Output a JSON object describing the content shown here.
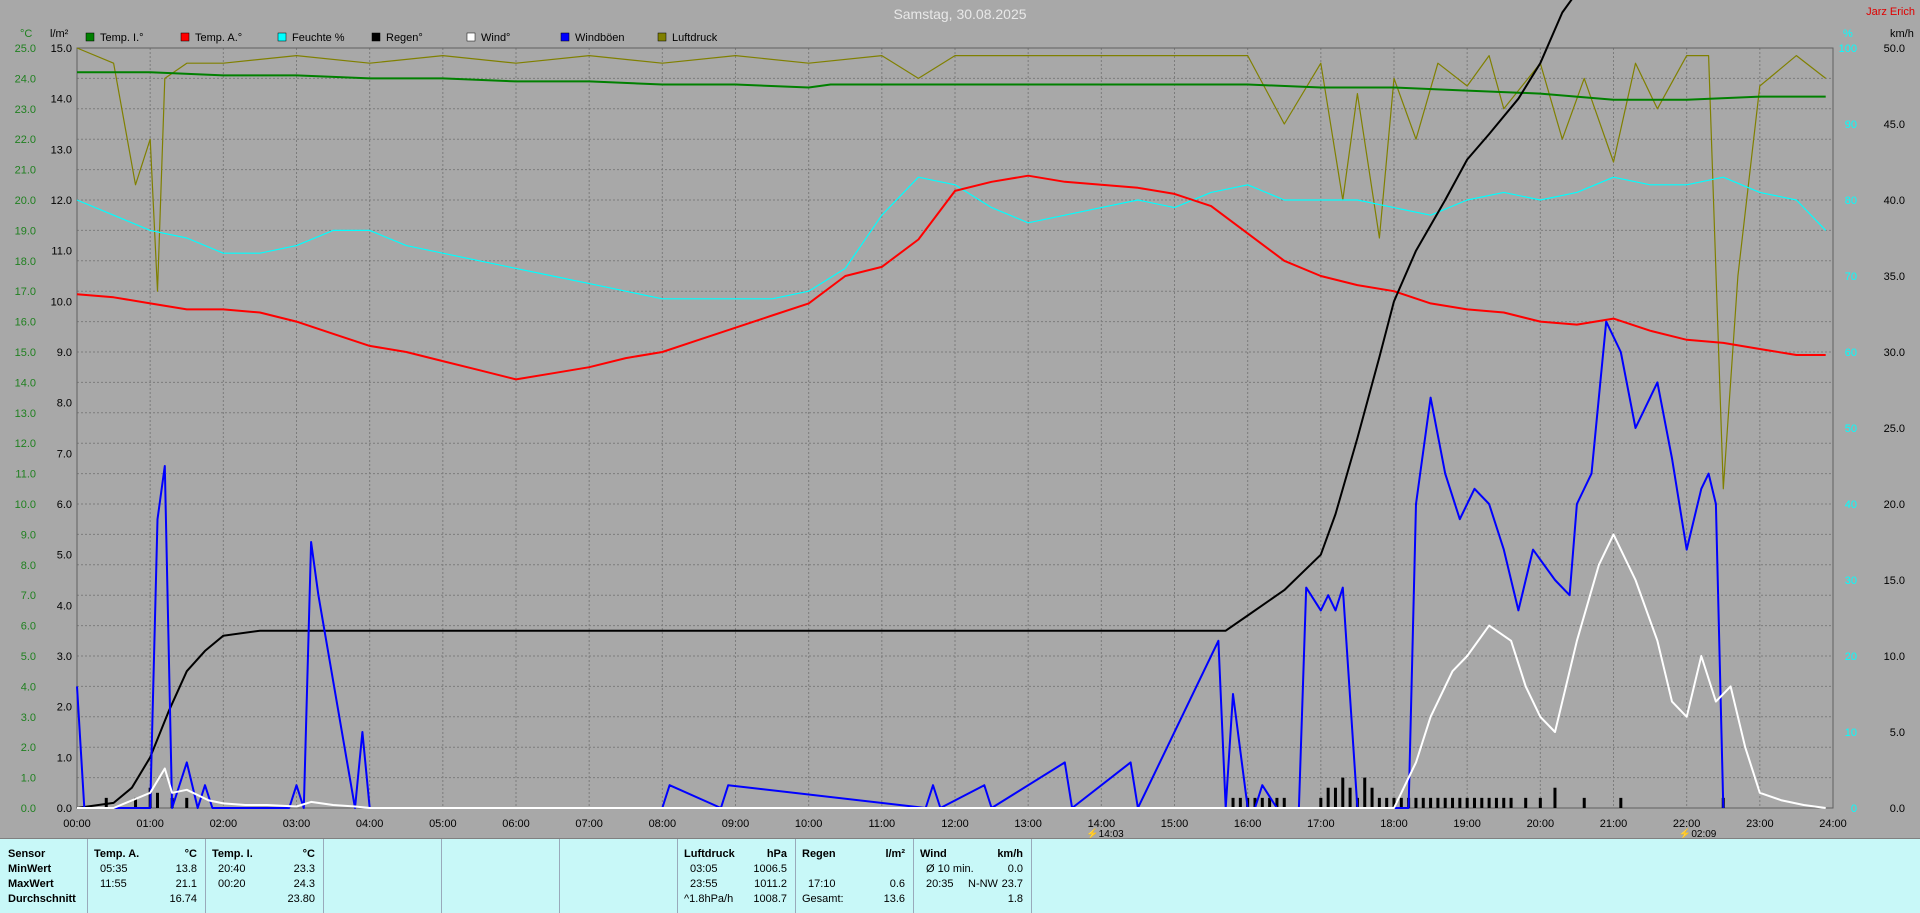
{
  "window": {
    "title": "Samstag, 30.08.2025",
    "credit": "Jarz Erich"
  },
  "axes": {
    "left_temp_unit": "°C",
    "left_rain_unit": "l/m²",
    "right_wind_unit": "km/h",
    "right_humidity_unit": "%",
    "temp_ticks": [
      "0.0",
      "1.0",
      "2.0",
      "3.0",
      "4.0",
      "5.0",
      "6.0",
      "7.0",
      "8.0",
      "9.0",
      "10.0",
      "11.0",
      "12.0",
      "13.0",
      "14.0",
      "15.0",
      "16.0",
      "17.0",
      "18.0",
      "19.0",
      "20.0",
      "21.0",
      "22.0",
      "23.0",
      "24.0",
      "25.0"
    ],
    "rain_ticks": [
      "0.0",
      "1.0",
      "2.0",
      "3.0",
      "4.0",
      "5.0",
      "6.0",
      "7.0",
      "8.0",
      "9.0",
      "10.0",
      "11.0",
      "12.0",
      "13.0",
      "14.0",
      "15.0"
    ],
    "wind_ticks": [
      "0.0",
      "5.0",
      "10.0",
      "15.0",
      "20.0",
      "25.0",
      "30.0",
      "35.0",
      "40.0",
      "45.0",
      "50.0"
    ],
    "humidity_ticks": [
      "0",
      "10",
      "20",
      "30",
      "40",
      "50",
      "60",
      "70",
      "80",
      "90",
      "100"
    ],
    "x_ticks": [
      "00:00",
      "01:00",
      "02:00",
      "03:00",
      "04:00",
      "05:00",
      "06:00",
      "07:00",
      "08:00",
      "09:00",
      "10:00",
      "11:00",
      "12:00",
      "13:00",
      "14:00",
      "15:00",
      "16:00",
      "17:00",
      "18:00",
      "19:00",
      "20:00",
      "21:00",
      "22:00",
      "23:00",
      "24:00"
    ],
    "sun_markers": [
      "14:03",
      "02:09"
    ]
  },
  "legend": [
    {
      "label": "Temp. I.°",
      "color": "#008000"
    },
    {
      "label": "Temp. A.°",
      "color": "#ff0000"
    },
    {
      "label": "Feuchte %",
      "color": "#00ffff"
    },
    {
      "label": "Regen°",
      "color": "#000000"
    },
    {
      "label": "Wind°",
      "color": "#ffffff"
    },
    {
      "label": "Windböen",
      "color": "#0000ff"
    },
    {
      "label": "Luftdruck",
      "color": "#808000"
    }
  ],
  "chart_data": {
    "type": "line",
    "title": "Samstag, 30.08.2025",
    "x_unit": "hour",
    "xlim": [
      0,
      24
    ],
    "temp_ylim": [
      0,
      25
    ],
    "rain_ylim": [
      0,
      15
    ],
    "wind_ylim": [
      0,
      50
    ],
    "humidity_ylim": [
      0,
      100
    ],
    "grid": true,
    "legend_position": "top",
    "series": [
      {
        "name": "Temp. I.°",
        "axis": "temp",
        "color": "#008000",
        "x": [
          0,
          1,
          2,
          3,
          4,
          5,
          6,
          7,
          8,
          9,
          10,
          10.3,
          11,
          12,
          13,
          14,
          15,
          16,
          17,
          18,
          19,
          20,
          21,
          22,
          23,
          23.9
        ],
        "y": [
          24.2,
          24.2,
          24.1,
          24.1,
          24.0,
          24.0,
          23.9,
          23.9,
          23.8,
          23.8,
          23.7,
          23.8,
          23.8,
          23.8,
          23.8,
          23.8,
          23.8,
          23.8,
          23.7,
          23.7,
          23.6,
          23.5,
          23.3,
          23.3,
          23.4,
          23.4
        ]
      },
      {
        "name": "Temp. A.°",
        "axis": "temp",
        "color": "#ff0000",
        "x": [
          0,
          0.5,
          1,
          1.5,
          2,
          2.5,
          3,
          3.5,
          4,
          4.5,
          5,
          5.5,
          6,
          6.5,
          7,
          7.5,
          8,
          8.5,
          9,
          9.5,
          10,
          10.5,
          11,
          11.5,
          12,
          12.5,
          13,
          13.5,
          14,
          14.5,
          15,
          15.5,
          16,
          16.5,
          17,
          17.5,
          18,
          18.5,
          19,
          19.5,
          20,
          20.5,
          21,
          21.5,
          22,
          22.5,
          23,
          23.5,
          23.9
        ],
        "y": [
          16.9,
          16.8,
          16.6,
          16.4,
          16.4,
          16.3,
          16.0,
          15.6,
          15.2,
          15.0,
          14.7,
          14.4,
          14.1,
          14.3,
          14.5,
          14.8,
          15.0,
          15.4,
          15.8,
          16.2,
          16.6,
          17.5,
          17.8,
          18.7,
          20.3,
          20.6,
          20.8,
          20.6,
          20.5,
          20.4,
          20.2,
          19.8,
          18.9,
          18.0,
          17.5,
          17.2,
          17.0,
          16.6,
          16.4,
          16.3,
          16.0,
          15.9,
          16.1,
          15.7,
          15.4,
          15.3,
          15.1,
          14.9,
          14.9
        ]
      },
      {
        "name": "Feuchte %",
        "axis": "humidity",
        "color": "#00ffff",
        "x": [
          0,
          0.5,
          1,
          1.5,
          2,
          2.5,
          3,
          3.5,
          4,
          4.5,
          5,
          5.5,
          6,
          6.5,
          7,
          7.5,
          8,
          8.5,
          9,
          9.5,
          10,
          10.5,
          11,
          11.5,
          12,
          12.5,
          13,
          13.5,
          14,
          14.5,
          15,
          15.5,
          16,
          16.5,
          17,
          17.5,
          18,
          18.5,
          19,
          19.5,
          20,
          20.5,
          21,
          21.5,
          22,
          22.5,
          23,
          23.5,
          23.9
        ],
        "y": [
          80,
          78,
          76,
          75,
          73,
          73,
          74,
          76,
          76,
          74,
          73,
          72,
          71,
          70,
          69,
          68,
          67,
          67,
          67,
          67,
          68,
          71,
          78,
          83,
          82,
          79,
          77,
          78,
          79,
          80,
          79,
          81,
          82,
          80,
          80,
          80,
          79,
          78,
          80,
          81,
          80,
          81,
          83,
          82,
          82,
          83,
          81,
          80,
          76
        ]
      },
      {
        "name": "Regen°",
        "axis": "rain",
        "color": "#000000",
        "x": [
          0,
          0.5,
          0.75,
          1,
          1.25,
          1.5,
          1.75,
          2,
          2.5,
          3,
          4,
          5,
          6,
          7,
          8,
          9,
          10,
          11,
          12,
          13,
          14,
          15,
          15.7,
          16,
          16.5,
          17,
          17.2,
          17.5,
          17.8,
          18,
          18.3,
          18.7,
          19,
          19.3,
          19.7,
          20,
          20.3,
          20.6,
          21,
          21.5,
          22,
          22.5,
          23,
          23.9
        ],
        "y": [
          0,
          0.1,
          0.4,
          1.0,
          1.9,
          2.7,
          3.1,
          3.4,
          3.5,
          3.5,
          3.5,
          3.5,
          3.5,
          3.5,
          3.5,
          3.5,
          3.5,
          3.5,
          3.5,
          3.5,
          3.5,
          3.5,
          3.5,
          3.8,
          4.3,
          5.0,
          5.8,
          7.3,
          8.9,
          10.0,
          11.0,
          12.0,
          12.8,
          13.3,
          14.0,
          14.7,
          15.7,
          16.3,
          16.8,
          16.9,
          16.9,
          17.1,
          17.2,
          17.2
        ]
      },
      {
        "name": "Wind°",
        "axis": "wind",
        "color": "#ffffff",
        "x": [
          0,
          0.5,
          1,
          1.2,
          1.3,
          1.5,
          1.8,
          2,
          2.3,
          2.6,
          3,
          3.2,
          3.5,
          3.8,
          4,
          5,
          6,
          7,
          8,
          9,
          10,
          11,
          12,
          13,
          14,
          15,
          16,
          17,
          18,
          18.3,
          18.5,
          18.8,
          19,
          19.3,
          19.6,
          19.8,
          20,
          20.2,
          20.5,
          20.8,
          21,
          21.3,
          21.6,
          21.8,
          22,
          22.2,
          22.4,
          22.6,
          22.8,
          23,
          23.3,
          23.6,
          23.9
        ],
        "y": [
          0,
          0,
          1,
          2.6,
          1,
          1.2,
          0.5,
          0.3,
          0.2,
          0.2,
          0.1,
          0.4,
          0.2,
          0.1,
          0,
          0,
          0,
          0,
          0,
          0,
          0,
          0,
          0,
          0,
          0,
          0,
          0,
          0,
          0,
          3,
          6,
          9,
          10,
          12,
          11,
          8,
          6,
          5,
          11,
          16,
          18,
          15,
          11,
          7,
          6,
          10,
          7,
          8,
          4,
          1,
          0.5,
          0.2,
          0
        ]
      },
      {
        "name": "Windböen",
        "axis": "wind",
        "color": "#0000ff",
        "x": [
          0,
          0.1,
          0.2,
          1.0,
          1.1,
          1.2,
          1.3,
          1.5,
          1.65,
          1.75,
          1.85,
          2.9,
          3.0,
          3.1,
          3.2,
          3.3,
          3.8,
          3.9,
          4.0,
          8.0,
          8.1,
          8.8,
          8.9,
          11.6,
          11.7,
          11.8,
          12.4,
          12.5,
          13.5,
          13.6,
          14.4,
          14.5,
          15.6,
          15.7,
          15.8,
          16.0,
          16.1,
          16.2,
          16.4,
          16.7,
          16.8,
          17.0,
          17.1,
          17.2,
          17.3,
          17.5,
          18.2,
          18.3,
          18.5,
          18.7,
          18.9,
          19.1,
          19.3,
          19.5,
          19.7,
          19.9,
          20.2,
          20.4,
          20.5,
          20.7,
          20.9,
          21.1,
          21.3,
          21.6,
          21.8,
          22.0,
          22.2,
          22.3,
          22.4,
          22.5
        ],
        "y": [
          8,
          0,
          0,
          0,
          19,
          22.5,
          0,
          3,
          0,
          1.5,
          0,
          0,
          1.5,
          0,
          17.5,
          14,
          0,
          5,
          0,
          0,
          1.5,
          0,
          1.5,
          0,
          1.5,
          0,
          1.5,
          0,
          3,
          0,
          3,
          0,
          11,
          0,
          7.5,
          0,
          0,
          1.5,
          0,
          0,
          14.5,
          13,
          14,
          13,
          14.5,
          0,
          0,
          20,
          27,
          22,
          19,
          21,
          20,
          17,
          13,
          17,
          15,
          14,
          20,
          22,
          32,
          30,
          25,
          28,
          23,
          17,
          21,
          22,
          20,
          0
        ]
      },
      {
        "name": "Luftdruck",
        "axis": "humidity",
        "color": "#808000",
        "x": [
          0,
          0.5,
          0.8,
          1.0,
          1.1,
          1.2,
          1.5,
          2,
          3,
          4,
          5,
          6,
          7,
          8,
          9,
          10,
          11,
          11.5,
          12,
          13,
          14,
          15,
          16,
          16.5,
          17,
          17.3,
          17.5,
          17.8,
          18,
          18.3,
          18.6,
          19,
          19.3,
          19.5,
          20,
          20.3,
          20.6,
          21,
          21.3,
          21.6,
          22,
          22.3,
          22.5,
          22.7,
          23,
          23.5,
          23.9
        ],
        "y": [
          100,
          98,
          82,
          88,
          68,
          96,
          98,
          98,
          99,
          98,
          99,
          98,
          99,
          98,
          99,
          98,
          99,
          96,
          99,
          99,
          99,
          99,
          99,
          90,
          98,
          80,
          94,
          75,
          96,
          88,
          98,
          95,
          99,
          92,
          98,
          88,
          96,
          85,
          98,
          92,
          99,
          99,
          42,
          70,
          95,
          99,
          96
        ]
      }
    ],
    "rain_bars": {
      "x": [
        0.4,
        0.8,
        1.0,
        1.1,
        1.3,
        1.5,
        15.8,
        15.9,
        16.0,
        16.1,
        16.2,
        16.3,
        16.4,
        16.5,
        17.0,
        17.1,
        17.2,
        17.3,
        17.4,
        17.5,
        17.6,
        17.7,
        17.8,
        17.9,
        18.0,
        18.1,
        18.2,
        18.3,
        18.4,
        18.5,
        18.6,
        18.7,
        18.8,
        18.9,
        19.0,
        19.1,
        19.2,
        19.3,
        19.4,
        19.5,
        19.6,
        19.8,
        20.0,
        20.2,
        20.6,
        21.1,
        22.5
      ],
      "y": [
        0.2,
        0.2,
        0.4,
        0.3,
        0.2,
        0.2,
        0.2,
        0.2,
        0.2,
        0.2,
        0.2,
        0.2,
        0.2,
        0.2,
        0.2,
        0.4,
        0.4,
        0.6,
        0.4,
        0.2,
        0.6,
        0.4,
        0.2,
        0.2,
        0.2,
        0.2,
        0.2,
        0.2,
        0.2,
        0.2,
        0.2,
        0.2,
        0.2,
        0.2,
        0.2,
        0.2,
        0.2,
        0.2,
        0.2,
        0.2,
        0.2,
        0.2,
        0.2,
        0.4,
        0.2,
        0.2,
        0.2
      ]
    }
  },
  "table": {
    "sensor": {
      "header": "Sensor",
      "rows": [
        "MinWert",
        "MaxWert",
        "Durchschnitt"
      ]
    },
    "temp_a": {
      "header": "Temp. A.",
      "unit": "°C",
      "times": [
        "05:35",
        "11:55",
        ""
      ],
      "values": [
        "13.8",
        "21.1",
        "16.74"
      ]
    },
    "temp_i": {
      "header": "Temp. I.",
      "unit": "°C",
      "times": [
        "20:40",
        "00:20",
        ""
      ],
      "values": [
        "23.3",
        "24.3",
        "23.80"
      ]
    },
    "pressure": {
      "header": "Luftdruck",
      "unit": "hPa",
      "times": [
        "03:05",
        "23:55",
        "^1.8hPa/h"
      ],
      "values": [
        "1006.5",
        "1011.2",
        "1008.7"
      ]
    },
    "rain": {
      "header": "Regen",
      "unit": "l/m²",
      "times": [
        "",
        "17:10",
        "Gesamt:"
      ],
      "values": [
        "",
        "0.6",
        "13.6"
      ]
    },
    "wind": {
      "header": "Wind",
      "unit": "km/h",
      "times": [
        "Ø 10 min.",
        "20:35",
        ""
      ],
      "dir": [
        "",
        "N-NW",
        ""
      ],
      "values": [
        "0.0",
        "23.7",
        "1.8"
      ]
    }
  }
}
